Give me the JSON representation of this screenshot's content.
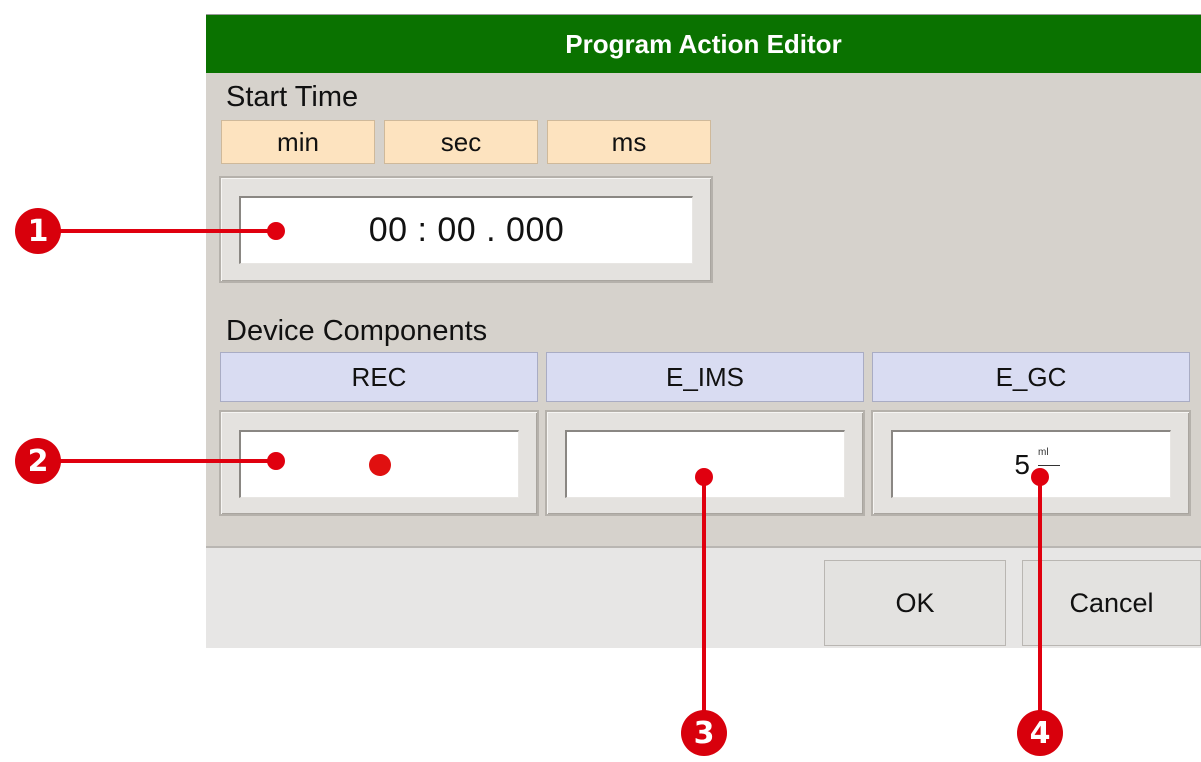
{
  "dialog": {
    "title": "Program Action Editor",
    "start_time": {
      "label": "Start Time",
      "units": [
        "min",
        "sec",
        "ms"
      ],
      "value": "00 : 00 . 000"
    },
    "device_components": {
      "label": "Device Components",
      "columns": [
        {
          "name": "REC",
          "value_indicator": "red-dot"
        },
        {
          "name": "E_IMS",
          "value": ""
        },
        {
          "name": "E_GC",
          "value": "5",
          "unit": "ml"
        }
      ]
    },
    "buttons": {
      "ok": "OK",
      "cancel": "Cancel"
    }
  },
  "callouts": [
    "1",
    "2",
    "3",
    "4"
  ],
  "colors": {
    "titlebar": "#0a7200",
    "unit_label_bg": "#fde3bf",
    "component_header_bg": "#d9dcf2",
    "callout": "#d8000c",
    "rec_dot": "#e01010"
  }
}
